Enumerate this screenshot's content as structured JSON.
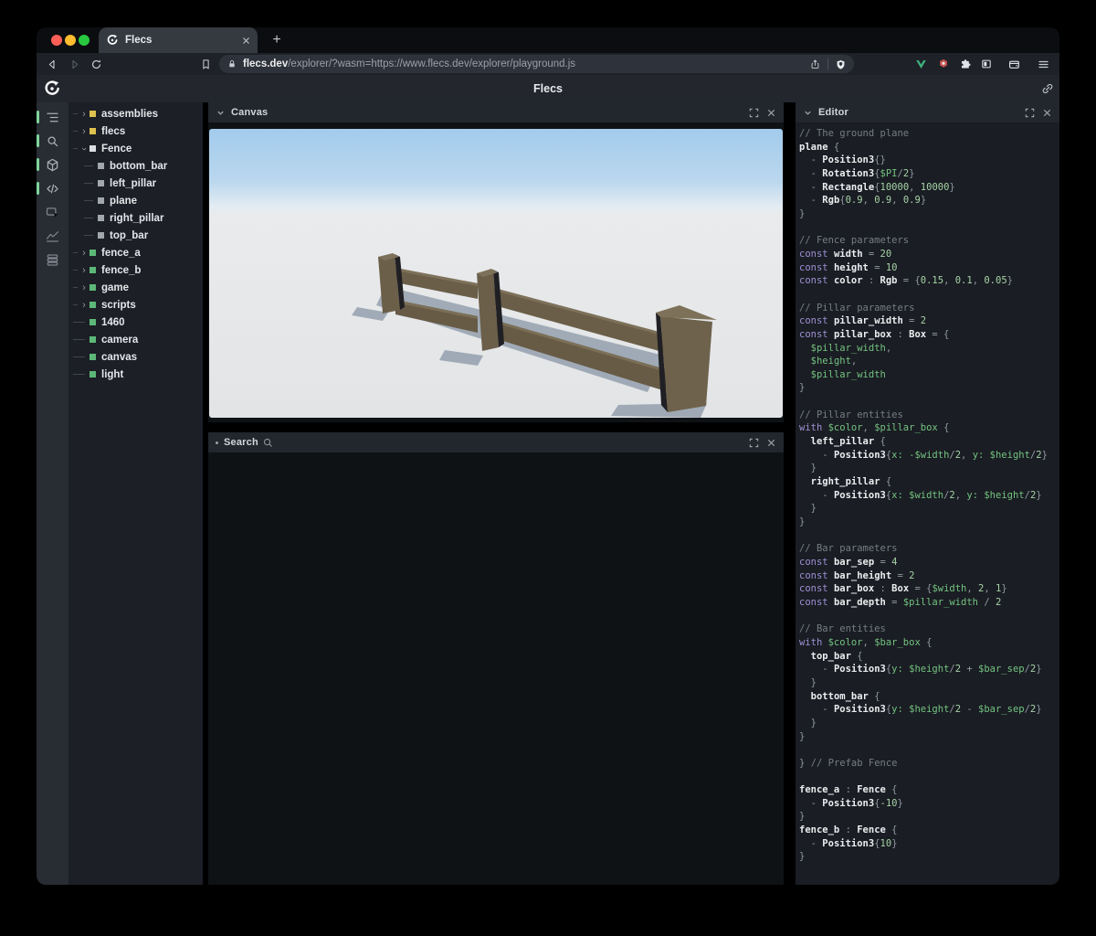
{
  "browser": {
    "tab_title": "Flecs",
    "new_tab_label": "+",
    "url": {
      "host": "flecs.dev",
      "path": "/explorer/?wasm=https://www.flecs.dev/explorer/playground.js"
    }
  },
  "header": {
    "title": "Flecs"
  },
  "sidebar": {
    "items": [
      {
        "icon": "hierarchy-icon",
        "active": true
      },
      {
        "icon": "search-icon",
        "active": true
      },
      {
        "icon": "cube-icon",
        "active": true
      },
      {
        "icon": "code-icon",
        "active": true
      },
      {
        "icon": "inspector-icon",
        "active": false
      },
      {
        "icon": "chart-icon",
        "active": false
      },
      {
        "icon": "stack-icon",
        "active": false
      }
    ]
  },
  "tree": {
    "items": [
      {
        "label": "assemblies",
        "state": "closed",
        "color": "yellow",
        "depth": 0
      },
      {
        "label": "flecs",
        "state": "closed",
        "color": "yellow",
        "depth": 0
      },
      {
        "label": "Fence",
        "state": "open",
        "color": "white",
        "depth": 0
      },
      {
        "label": "bottom_bar",
        "state": "leaf",
        "color": "gray",
        "depth": 1
      },
      {
        "label": "left_pillar",
        "state": "leaf",
        "color": "gray",
        "depth": 1
      },
      {
        "label": "plane",
        "state": "leaf",
        "color": "gray",
        "depth": 1
      },
      {
        "label": "right_pillar",
        "state": "leaf",
        "color": "gray",
        "depth": 1
      },
      {
        "label": "top_bar",
        "state": "leaf",
        "color": "gray",
        "depth": 1
      },
      {
        "label": "fence_a",
        "state": "closed",
        "color": "green",
        "depth": 0
      },
      {
        "label": "fence_b",
        "state": "closed",
        "color": "green",
        "depth": 0
      },
      {
        "label": "game",
        "state": "closed",
        "color": "green",
        "depth": 0
      },
      {
        "label": "scripts",
        "state": "closed",
        "color": "green",
        "depth": 0
      },
      {
        "label": "1460",
        "state": "leaf",
        "color": "green",
        "depth": 0
      },
      {
        "label": "camera",
        "state": "leaf",
        "color": "green",
        "depth": 0
      },
      {
        "label": "canvas",
        "state": "leaf",
        "color": "green",
        "depth": 0
      },
      {
        "label": "light",
        "state": "leaf",
        "color": "green",
        "depth": 0
      }
    ]
  },
  "panels": {
    "canvas": {
      "title": "Canvas"
    },
    "search": {
      "title": "Search"
    },
    "editor": {
      "title": "Editor"
    }
  },
  "colors": {
    "accent_green": "#7ed49a",
    "tree_yellow": "#dec14e",
    "tree_green": "#5cb878",
    "sky_top": "#a2cbec",
    "ground": "#e7e9ea",
    "wood_front": "#6a5e48",
    "wood_top": "#7d7159",
    "wood_dark": "#202024",
    "shadow": "#4e6279",
    "code_comment": "#767d86",
    "code_keyword": "#9f90d6",
    "code_number": "#a6d3a7",
    "code_variable": "#74c381"
  },
  "editor_code": {
    "lines": [
      [
        [
          "cm",
          "// The ground plane"
        ]
      ],
      [
        [
          "id",
          "plane"
        ],
        [
          "pu",
          " {"
        ]
      ],
      [
        [
          "pu",
          "  - "
        ],
        [
          "id",
          "Position3"
        ],
        [
          "pu",
          "{}"
        ]
      ],
      [
        [
          "pu",
          "  - "
        ],
        [
          "id",
          "Rotation3"
        ],
        [
          "pu",
          "{"
        ],
        [
          "va",
          "$PI"
        ],
        [
          "pu",
          "/"
        ],
        [
          "nu",
          "2"
        ],
        [
          "pu",
          "}"
        ]
      ],
      [
        [
          "pu",
          "  - "
        ],
        [
          "id",
          "Rectangle"
        ],
        [
          "pu",
          "{"
        ],
        [
          "nu",
          "10000"
        ],
        [
          "pu",
          ", "
        ],
        [
          "nu",
          "10000"
        ],
        [
          "pu",
          "}"
        ]
      ],
      [
        [
          "pu",
          "  - "
        ],
        [
          "id",
          "Rgb"
        ],
        [
          "pu",
          "{"
        ],
        [
          "nu",
          "0.9"
        ],
        [
          "pu",
          ", "
        ],
        [
          "nu",
          "0.9"
        ],
        [
          "pu",
          ", "
        ],
        [
          "nu",
          "0.9"
        ],
        [
          "pu",
          "}"
        ]
      ],
      [
        [
          "pu",
          "}"
        ]
      ],
      [],
      [
        [
          "cm",
          "// Fence parameters"
        ]
      ],
      [
        [
          "kw",
          "const "
        ],
        [
          "id",
          "width"
        ],
        [
          "pu",
          " = "
        ],
        [
          "nu",
          "20"
        ]
      ],
      [
        [
          "kw",
          "const "
        ],
        [
          "id",
          "height"
        ],
        [
          "pu",
          " = "
        ],
        [
          "nu",
          "10"
        ]
      ],
      [
        [
          "kw",
          "const "
        ],
        [
          "id",
          "color"
        ],
        [
          "pu",
          " : "
        ],
        [
          "ty",
          "Rgb"
        ],
        [
          "pu",
          " = {"
        ],
        [
          "nu",
          "0.15"
        ],
        [
          "pu",
          ", "
        ],
        [
          "nu",
          "0.1"
        ],
        [
          "pu",
          ", "
        ],
        [
          "nu",
          "0.05"
        ],
        [
          "pu",
          "}"
        ]
      ],
      [],
      [
        [
          "cm",
          "// Pillar parameters"
        ]
      ],
      [
        [
          "kw",
          "const "
        ],
        [
          "id",
          "pillar_width"
        ],
        [
          "pu",
          " = "
        ],
        [
          "nu",
          "2"
        ]
      ],
      [
        [
          "kw",
          "const "
        ],
        [
          "id",
          "pillar_box"
        ],
        [
          "pu",
          " : "
        ],
        [
          "ty",
          "Box"
        ],
        [
          "pu",
          " = {"
        ]
      ],
      [
        [
          "pu",
          "  "
        ],
        [
          "va",
          "$pillar_width"
        ],
        [
          "pu",
          ","
        ]
      ],
      [
        [
          "pu",
          "  "
        ],
        [
          "va",
          "$height"
        ],
        [
          "pu",
          ","
        ]
      ],
      [
        [
          "pu",
          "  "
        ],
        [
          "va",
          "$pillar_width"
        ]
      ],
      [
        [
          "pu",
          "}"
        ]
      ],
      [],
      [
        [
          "cm",
          "// Pillar entities"
        ]
      ],
      [
        [
          "kw",
          "with "
        ],
        [
          "va",
          "$color"
        ],
        [
          "pu",
          ", "
        ],
        [
          "va",
          "$pillar_box"
        ],
        [
          "pu",
          " {"
        ]
      ],
      [
        [
          "pu",
          "  "
        ],
        [
          "id",
          "left_pillar"
        ],
        [
          "pu",
          " {"
        ]
      ],
      [
        [
          "pu",
          "    - "
        ],
        [
          "id",
          "Position3"
        ],
        [
          "pu",
          "{"
        ],
        [
          "va",
          "x: -$width"
        ],
        [
          "pu",
          "/"
        ],
        [
          "nu",
          "2"
        ],
        [
          "pu",
          ", "
        ],
        [
          "va",
          "y: $height"
        ],
        [
          "pu",
          "/"
        ],
        [
          "nu",
          "2"
        ],
        [
          "pu",
          "}"
        ]
      ],
      [
        [
          "pu",
          "  }"
        ]
      ],
      [
        [
          "pu",
          "  "
        ],
        [
          "id",
          "right_pillar"
        ],
        [
          "pu",
          " {"
        ]
      ],
      [
        [
          "pu",
          "    - "
        ],
        [
          "id",
          "Position3"
        ],
        [
          "pu",
          "{"
        ],
        [
          "va",
          "x: $width"
        ],
        [
          "pu",
          "/"
        ],
        [
          "nu",
          "2"
        ],
        [
          "pu",
          ", "
        ],
        [
          "va",
          "y: $height"
        ],
        [
          "pu",
          "/"
        ],
        [
          "nu",
          "2"
        ],
        [
          "pu",
          "}"
        ]
      ],
      [
        [
          "pu",
          "  }"
        ]
      ],
      [
        [
          "pu",
          "}"
        ]
      ],
      [],
      [
        [
          "cm",
          "// Bar parameters"
        ]
      ],
      [
        [
          "kw",
          "const "
        ],
        [
          "id",
          "bar_sep"
        ],
        [
          "pu",
          " = "
        ],
        [
          "nu",
          "4"
        ]
      ],
      [
        [
          "kw",
          "const "
        ],
        [
          "id",
          "bar_height"
        ],
        [
          "pu",
          " = "
        ],
        [
          "nu",
          "2"
        ]
      ],
      [
        [
          "kw",
          "const "
        ],
        [
          "id",
          "bar_box"
        ],
        [
          "pu",
          " : "
        ],
        [
          "ty",
          "Box"
        ],
        [
          "pu",
          " = {"
        ],
        [
          "va",
          "$width"
        ],
        [
          "pu",
          ", "
        ],
        [
          "nu",
          "2"
        ],
        [
          "pu",
          ", "
        ],
        [
          "nu",
          "1"
        ],
        [
          "pu",
          "}"
        ]
      ],
      [
        [
          "kw",
          "const "
        ],
        [
          "id",
          "bar_depth"
        ],
        [
          "pu",
          " = "
        ],
        [
          "va",
          "$pillar_width"
        ],
        [
          "pu",
          " / "
        ],
        [
          "nu",
          "2"
        ]
      ],
      [],
      [
        [
          "cm",
          "// Bar entities"
        ]
      ],
      [
        [
          "kw",
          "with "
        ],
        [
          "va",
          "$color"
        ],
        [
          "pu",
          ", "
        ],
        [
          "va",
          "$bar_box"
        ],
        [
          "pu",
          " {"
        ]
      ],
      [
        [
          "pu",
          "  "
        ],
        [
          "id",
          "top_bar"
        ],
        [
          "pu",
          " {"
        ]
      ],
      [
        [
          "pu",
          "    - "
        ],
        [
          "id",
          "Position3"
        ],
        [
          "pu",
          "{"
        ],
        [
          "va",
          "y: $height"
        ],
        [
          "pu",
          "/"
        ],
        [
          "nu",
          "2"
        ],
        [
          "pu",
          " + "
        ],
        [
          "va",
          "$bar_sep"
        ],
        [
          "pu",
          "/"
        ],
        [
          "nu",
          "2"
        ],
        [
          "pu",
          "}"
        ]
      ],
      [
        [
          "pu",
          "  }"
        ]
      ],
      [
        [
          "pu",
          "  "
        ],
        [
          "id",
          "bottom_bar"
        ],
        [
          "pu",
          " {"
        ]
      ],
      [
        [
          "pu",
          "    - "
        ],
        [
          "id",
          "Position3"
        ],
        [
          "pu",
          "{"
        ],
        [
          "va",
          "y: $height"
        ],
        [
          "pu",
          "/"
        ],
        [
          "nu",
          "2"
        ],
        [
          "pu",
          " - "
        ],
        [
          "va",
          "$bar_sep"
        ],
        [
          "pu",
          "/"
        ],
        [
          "nu",
          "2"
        ],
        [
          "pu",
          "}"
        ]
      ],
      [
        [
          "pu",
          "  }"
        ]
      ],
      [
        [
          "pu",
          "}"
        ]
      ],
      [],
      [
        [
          "pu",
          "} "
        ],
        [
          "cm",
          "// Prefab Fence"
        ]
      ],
      [],
      [
        [
          "id",
          "fence_a"
        ],
        [
          "pu",
          " : "
        ],
        [
          "ty",
          "Fence"
        ],
        [
          "pu",
          " {"
        ]
      ],
      [
        [
          "pu",
          "  - "
        ],
        [
          "id",
          "Position3"
        ],
        [
          "pu",
          "{"
        ],
        [
          "nu",
          "-10"
        ],
        [
          "pu",
          "}"
        ]
      ],
      [
        [
          "pu",
          "}"
        ]
      ],
      [
        [
          "id",
          "fence_b"
        ],
        [
          "pu",
          " : "
        ],
        [
          "ty",
          "Fence"
        ],
        [
          "pu",
          " {"
        ]
      ],
      [
        [
          "pu",
          "  - "
        ],
        [
          "id",
          "Position3"
        ],
        [
          "pu",
          "{"
        ],
        [
          "nu",
          "10"
        ],
        [
          "pu",
          "}"
        ]
      ],
      [
        [
          "pu",
          "}"
        ]
      ]
    ]
  }
}
